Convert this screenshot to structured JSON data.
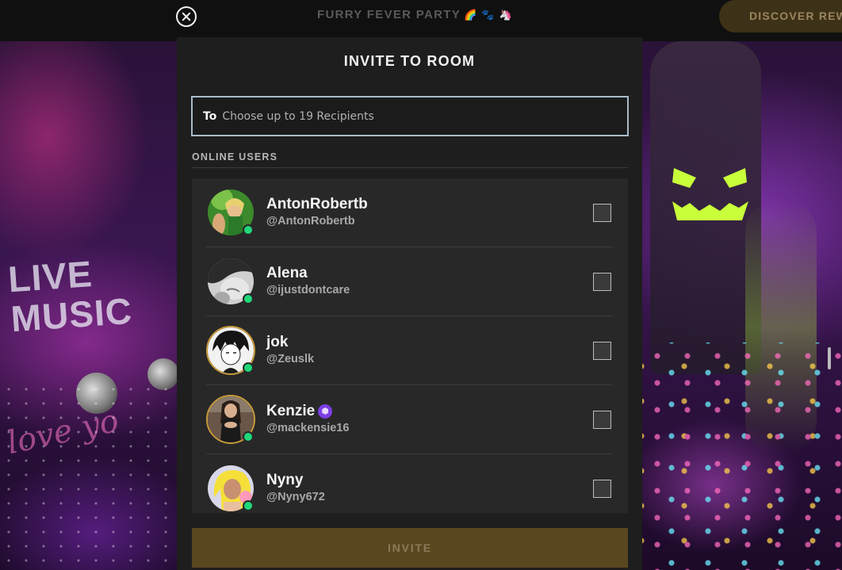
{
  "top_bar": {
    "room_title": "FURRY FEVER PARTY",
    "room_title_emoji": "🌈 🐾 🦄",
    "discover_label": "DISCOVER REW"
  },
  "background": {
    "sign_text": "LIVE\nMUSIC",
    "script_text": "love yo"
  },
  "modal": {
    "title": "INVITE TO ROOM",
    "to_label": "To",
    "to_placeholder": "Choose up to 19 Recipients",
    "section_label": "ONLINE USERS",
    "invite_label": "INVITE"
  },
  "users": [
    {
      "name": "AntonRobertb",
      "handle": "@AntonRobertb",
      "online": true,
      "badge": false
    },
    {
      "name": "Alena",
      "handle": "@ijustdontcare",
      "online": true,
      "badge": false
    },
    {
      "name": "jok",
      "handle": "@Zeuslk",
      "online": true,
      "badge": false
    },
    {
      "name": "Kenzie",
      "handle": "@mackensie16",
      "online": true,
      "badge": true,
      "badge_icon": "vip-cube-icon"
    },
    {
      "name": "Nyny",
      "handle": "@Nyny672",
      "online": true,
      "badge": false
    }
  ],
  "colors": {
    "online": "#1fd87a",
    "invite_button": "#5a4720",
    "badge": "#7b3fe4",
    "focus_border": "#a9bcc8"
  }
}
